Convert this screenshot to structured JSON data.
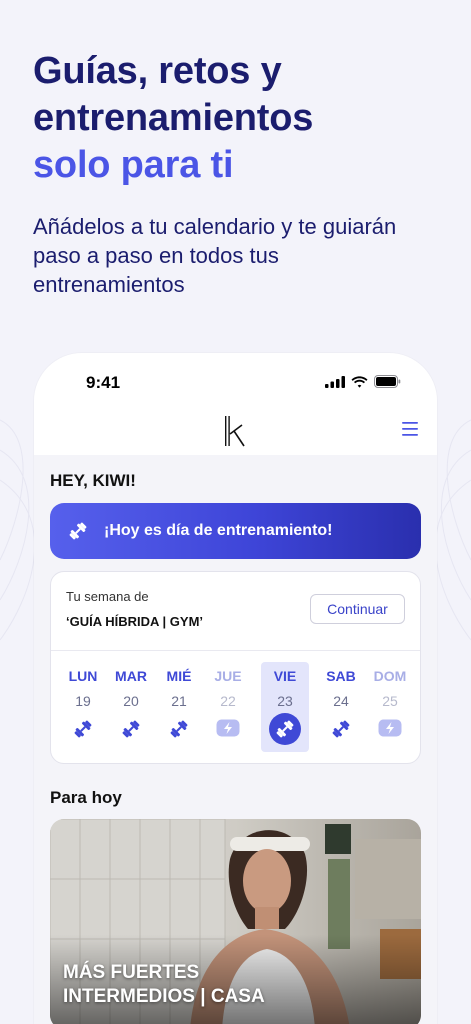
{
  "headline": {
    "line1": "Guías, retos y",
    "line2": "entrenamientos",
    "line3": "solo para ti"
  },
  "subtitle": {
    "line1": "Añádelos a tu calendario y te guiarán",
    "line2": "paso a paso en todos tus",
    "line3": "entrenamientos"
  },
  "status_bar": {
    "time": "9:41"
  },
  "app": {
    "greeting": "HEY, KIWI!",
    "banner_text": "¡Hoy es día de entrenamiento!",
    "week_label": "Tu semana de",
    "week_name": "‘GUÍA HÍBRIDA | GYM’",
    "continue_label": "Continuar",
    "days": [
      {
        "name": "LUN",
        "date": "19",
        "icon": "dumbbell-icon",
        "muted": false,
        "selected": false
      },
      {
        "name": "MAR",
        "date": "20",
        "icon": "dumbbell-icon",
        "muted": false,
        "selected": false
      },
      {
        "name": "MIÉ",
        "date": "21",
        "icon": "dumbbell-icon",
        "muted": false,
        "selected": false
      },
      {
        "name": "JUE",
        "date": "22",
        "icon": "bolt-icon",
        "muted": true,
        "selected": false
      },
      {
        "name": "VIE",
        "date": "23",
        "icon": "dumbbell-icon",
        "muted": false,
        "selected": true
      },
      {
        "name": "SAB",
        "date": "24",
        "icon": "dumbbell-icon",
        "muted": false,
        "selected": false
      },
      {
        "name": "DOM",
        "date": "25",
        "icon": "bolt-icon",
        "muted": true,
        "selected": false
      }
    ],
    "section_title": "Para hoy",
    "workout": {
      "line1": "MÁS FUERTES",
      "line2": "INTERMEDIOS | CASA"
    }
  },
  "colors": {
    "primary_dark": "#1B1D6E",
    "accent": "#4B55E6",
    "background": "#F3F3FA"
  }
}
